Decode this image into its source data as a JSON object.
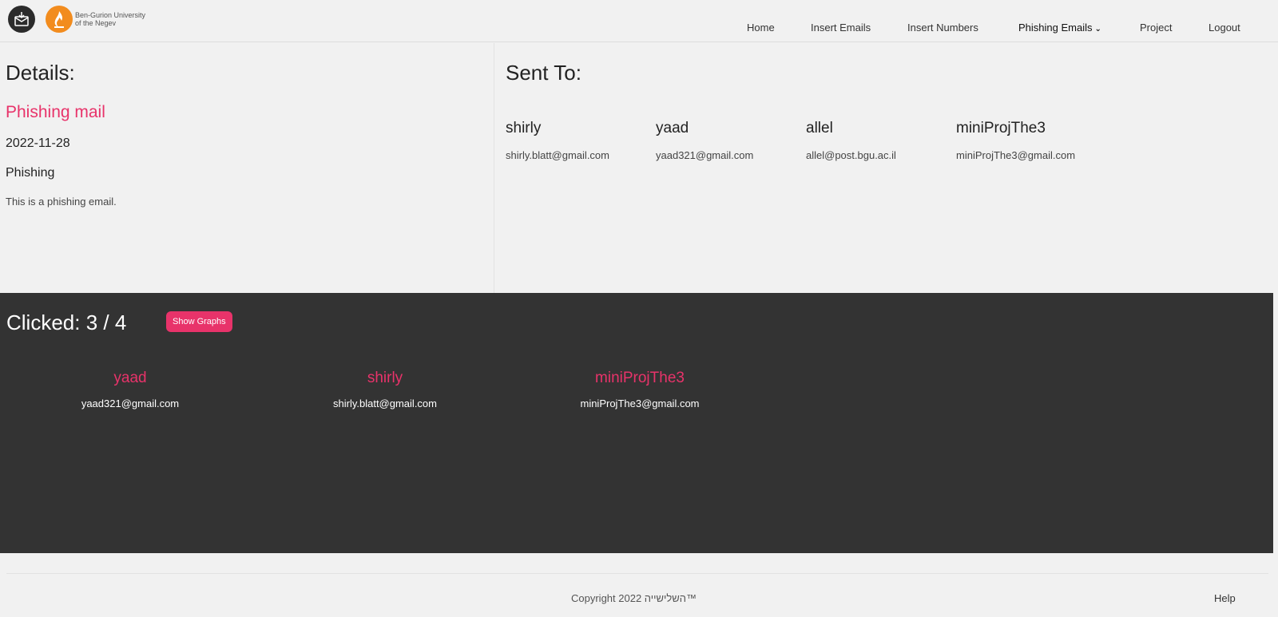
{
  "header": {
    "university_name_line1": "Ben-Gurion University",
    "university_name_line2": "of the Negev",
    "nav": [
      {
        "label": "Home"
      },
      {
        "label": "Insert Emails"
      },
      {
        "label": "Insert Numbers"
      },
      {
        "label": "Phishing Emails"
      },
      {
        "label": "Project"
      },
      {
        "label": "Logout"
      }
    ]
  },
  "details": {
    "heading": "Details:",
    "title": "Phishing mail",
    "date": "2022-11-28",
    "type": "Phishing",
    "description": "This is a phishing email."
  },
  "sent_to": {
    "heading": "Sent To:",
    "recipients": [
      {
        "name": "shirly",
        "email": "shirly.blatt@gmail.com"
      },
      {
        "name": "yaad",
        "email": "yaad321@gmail.com"
      },
      {
        "name": "allel",
        "email": "allel@post.bgu.ac.il"
      },
      {
        "name": "miniProjThe3",
        "email": "miniProjThe3@gmail.com"
      }
    ]
  },
  "clicked": {
    "title": "Clicked: 3 / 4",
    "show_graphs_label": "Show Graphs",
    "items": [
      {
        "name": "yaad",
        "email": "yaad321@gmail.com"
      },
      {
        "name": "shirly",
        "email": "shirly.blatt@gmail.com"
      },
      {
        "name": "miniProjThe3",
        "email": "miniProjThe3@gmail.com"
      }
    ]
  },
  "footer": {
    "copyright": "Copyright 2022 השלישייה™",
    "help": "Help"
  },
  "colors": {
    "accent": "#e8336a",
    "panel_dark": "#333333",
    "background": "#f1f1f1",
    "bgu_orange": "#f28c1e"
  }
}
